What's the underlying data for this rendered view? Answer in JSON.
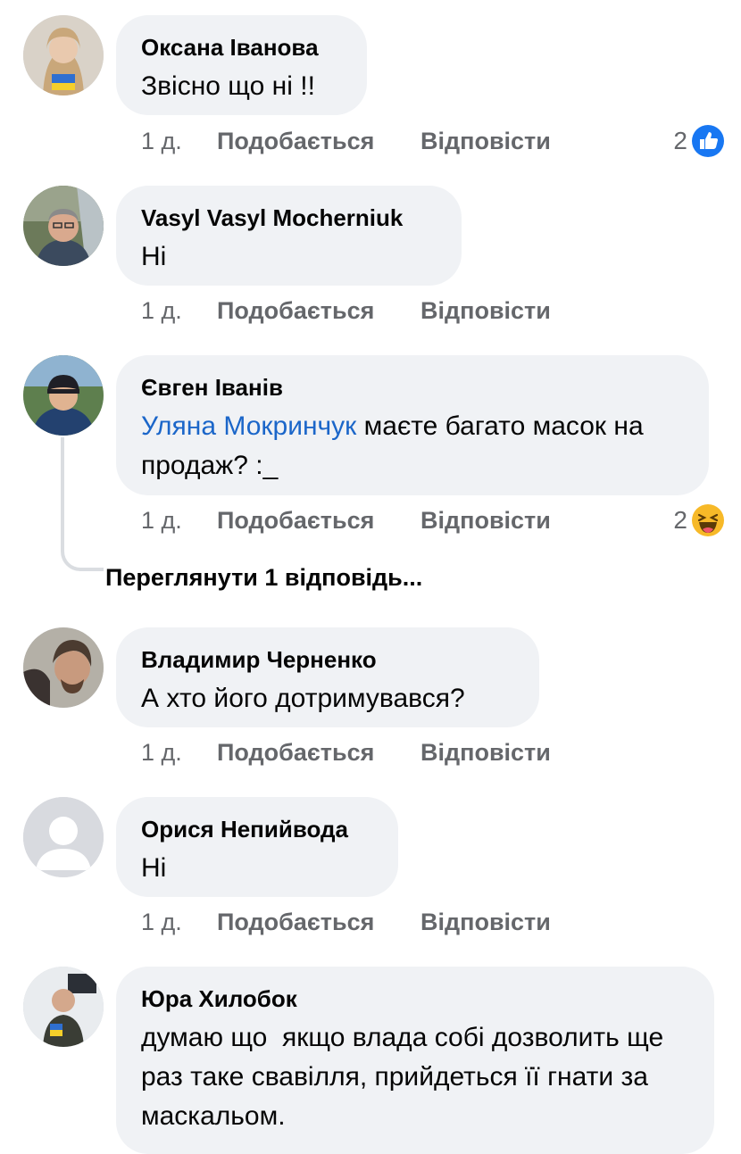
{
  "comments": [
    {
      "author": "Оксана Іванова",
      "text": "Звісно що ні !!",
      "time": "1 д.",
      "like_label": "Подобається",
      "reply_label": "Відповісти",
      "reaction_count": "2",
      "reaction_icon": "like-icon"
    },
    {
      "author": "Vasyl Vasyl Mocherniuk",
      "text": "Ні",
      "time": "1 д.",
      "like_label": "Подобається",
      "reply_label": "Відповісти"
    },
    {
      "author": "Євген Іванів",
      "mention": "Уляна Мокринчук",
      "text": " маєте багато масок на продаж? :_",
      "time": "1 д.",
      "like_label": "Подобається",
      "reply_label": "Відповісти",
      "reaction_count": "2",
      "reaction_icon": "haha-icon"
    },
    {
      "author": "Владимир Черненко",
      "text": "А хто його дотримувався?",
      "time": "1 д.",
      "like_label": "Подобається",
      "reply_label": "Відповісти"
    },
    {
      "author": "Орися Непийвода",
      "text": "Ні",
      "time": "1 д.",
      "like_label": "Подобається",
      "reply_label": "Відповісти"
    },
    {
      "author": "Юра Хилобок",
      "text": "думаю що  якщо влада собі дозволить ще раз таке свавілля, прийдеться її гнати за маскальом."
    }
  ],
  "view_replies_label": "Переглянути 1 відповідь...",
  "colors": {
    "accent": "#1877f2",
    "mention": "#1b66c9",
    "bubble": "#f0f2f5",
    "muted": "#65676b",
    "haha": "#f7b928"
  }
}
